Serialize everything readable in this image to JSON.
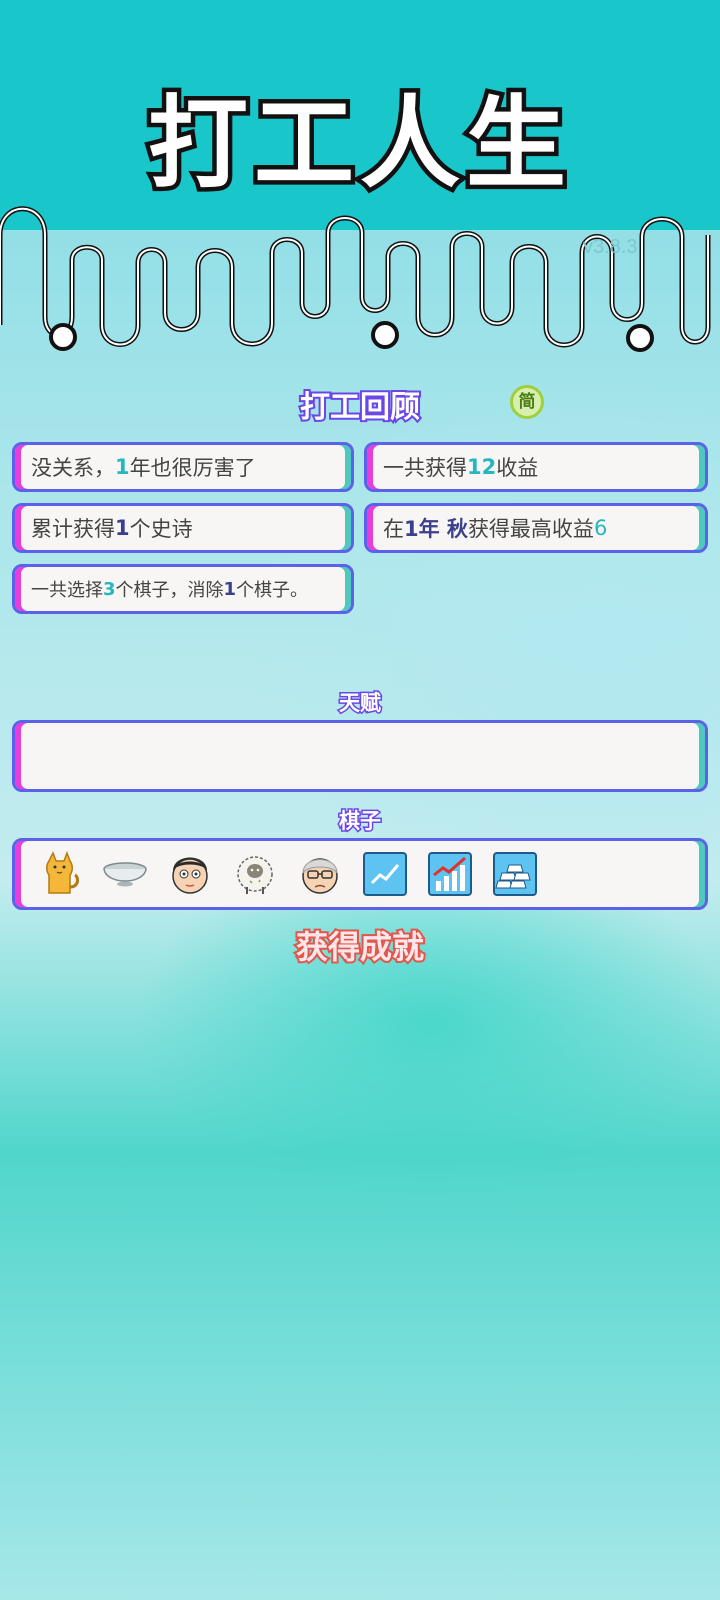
{
  "app": {
    "title": "打工人生",
    "version": "v3.8.3",
    "colors": {
      "header": "#19c6c9",
      "accent_purple": "#6b46e8",
      "accent_teal": "#25b6c0",
      "card_border": "#5b62e8",
      "card_left": "#e83ddc",
      "card_right": "#4fc9bd",
      "achievement": "#e0584b"
    }
  },
  "review": {
    "title": "打工回顾",
    "toggle_label": "简",
    "cards": [
      {
        "p1": "没关系，",
        "h1": "1",
        "p2": "年也很厉害了",
        "h2": "",
        "p3": ""
      },
      {
        "p1": "一共获得",
        "h1": "12",
        "p2": "收益",
        "h2": "",
        "p3": ""
      },
      {
        "p1": "累计获得",
        "h1": "1",
        "p2": "个史诗",
        "h2": "",
        "p3": ""
      },
      {
        "p1": "在 ",
        "h1": "1年 秋",
        "p2": " 获得最高收益",
        "h2": "6",
        "p3": ""
      },
      {
        "p1": "一共选择",
        "h1": "3",
        "p2": "个棋子，消除",
        "h2": "1",
        "p3": "个棋子。"
      }
    ]
  },
  "talent": {
    "title": "天赋",
    "items": []
  },
  "pieces": {
    "title": "棋子",
    "items": [
      "cat-icon",
      "bowl-icon",
      "face-icon",
      "sheep-icon",
      "old-man-icon",
      "trend-up-icon",
      "growth-chart-icon",
      "gold-bars-icon"
    ]
  },
  "achievements": {
    "title": "获得成就"
  }
}
